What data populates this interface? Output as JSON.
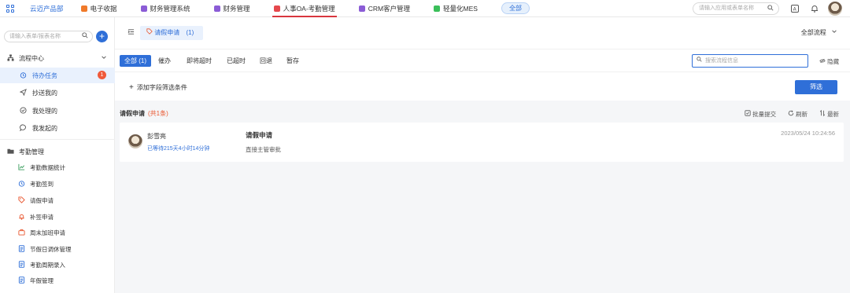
{
  "topbar": {
    "brand": "云迈产品部",
    "apps": [
      {
        "label": "电子收据",
        "icon": "receipt-app-icon",
        "color": "#f07a2a"
      },
      {
        "label": "财务管理系统",
        "icon": "finance-system-app-icon",
        "color": "#8b5cd6"
      },
      {
        "label": "财务管理",
        "icon": "finance-app-icon",
        "color": "#8b5cd6"
      },
      {
        "label": "人事OA-考勤管理",
        "icon": "hr-oa-app-icon",
        "color": "#e5484d"
      },
      {
        "label": "CRM客户管理",
        "icon": "crm-app-icon",
        "color": "#8b5cd6"
      },
      {
        "label": "轻量化MES",
        "icon": "mes-app-icon",
        "color": "#3bbf5a"
      }
    ],
    "all_label": "全部",
    "search_placeholder": "请输入应用或表单名称"
  },
  "sidebar": {
    "search_placeholder": "请输入表单/报表名称",
    "flow_center": {
      "label": "流程中心",
      "items": [
        {
          "label": "待办任务",
          "icon": "alarm-clock-icon",
          "badge": "1",
          "active": true
        },
        {
          "label": "抄送我的",
          "icon": "send-icon"
        },
        {
          "label": "我处理的",
          "icon": "check-circle-icon"
        },
        {
          "label": "我发起的",
          "icon": "chat-bubble-icon"
        }
      ]
    },
    "attendance": {
      "label": "考勤管理",
      "items": [
        {
          "label": "考勤数据统计",
          "icon": "chart-icon"
        },
        {
          "label": "考勤签到",
          "icon": "clock-icon"
        },
        {
          "label": "请假申请",
          "icon": "tag-icon"
        },
        {
          "label": "补签申请",
          "icon": "bell-icon"
        },
        {
          "label": "周末加班申请",
          "icon": "briefcase-icon"
        },
        {
          "label": "节假日调休管理",
          "icon": "document-icon"
        },
        {
          "label": "考勤周期录入",
          "icon": "document-icon"
        },
        {
          "label": "年假管理",
          "icon": "document-icon"
        }
      ]
    }
  },
  "tabbar": {
    "page_tab": "请假申请",
    "page_tab_count": "(1)",
    "flow_select": "全部流程"
  },
  "filters": {
    "tabs": [
      "全部 (1)",
      "催办",
      "即将超时",
      "已超时",
      "回退",
      "暂存"
    ],
    "search_placeholder": "搜索流程信息",
    "hide_label": "隐藏",
    "add_condition": "添加字段筛选条件",
    "filter_button": "筛选"
  },
  "list": {
    "title": "请假申请",
    "count": "(共1条)",
    "batch_submit": "批量提交",
    "refresh": "刷新",
    "latest": "最新",
    "rows": [
      {
        "name": "彭雪亮",
        "waited": "已等待215天4小时14分钟",
        "type": "请假申请",
        "step": "直接主管审批",
        "time": "2023/05/24 10:24:56"
      }
    ]
  }
}
